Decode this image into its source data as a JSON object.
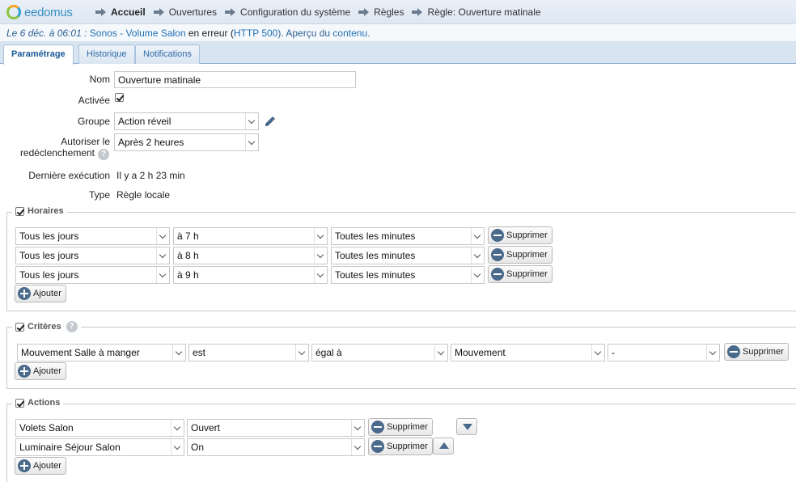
{
  "header": {
    "logo_text": "eedomus",
    "breadcrumbs": [
      "Accueil",
      "Ouvertures",
      "Configuration du système",
      "Règles",
      "Règle: Ouverture matinale"
    ]
  },
  "notification": {
    "date": "Le 6 déc. à 06:01 :",
    "device": "Sonos - Volume Salon",
    "status": "en erreur (",
    "error_code": "HTTP 500",
    "suffix": "). Aperçu du",
    "content_link": "contenu",
    "end": "."
  },
  "tabs": [
    {
      "label": "Paramétrage",
      "active": true
    },
    {
      "label": "Historique",
      "active": false
    },
    {
      "label": "Notifications",
      "active": false
    }
  ],
  "form": {
    "name_label": "Nom",
    "name_value": "Ouverture matinale",
    "active_label": "Activée",
    "active_checked": true,
    "group_label": "Groupe",
    "group_value": "Action réveil",
    "retrigger_label_1": "Autoriser le",
    "retrigger_label_2": "redéclenchement",
    "retrigger_value": "Après 2 heures",
    "last_exec_label": "Dernière exécution",
    "last_exec_value": "Il y a 2 h 23 min",
    "type_label": "Type",
    "type_value": "Règle locale"
  },
  "horaires": {
    "title": "Horaires",
    "rows": [
      {
        "day": "Tous les jours",
        "hour": "à 7 h",
        "minute": "Toutes les minutes",
        "delete": "Supprimer"
      },
      {
        "day": "Tous les jours",
        "hour": "à 8 h",
        "minute": "Toutes les minutes",
        "delete": "Supprimer"
      },
      {
        "day": "Tous les jours",
        "hour": "à 9 h",
        "minute": "Toutes les minutes",
        "delete": "Supprimer"
      }
    ],
    "add": "Ajouter"
  },
  "criteres": {
    "title": "Critères",
    "rows": [
      {
        "device": "Mouvement Salle à manger",
        "op": "est",
        "cmp": "égal à",
        "value": "Mouvement",
        "extra": "-",
        "delete": "Supprimer"
      }
    ],
    "add": "Ajouter"
  },
  "actions": {
    "title": "Actions",
    "rows": [
      {
        "device": "Volets Salon",
        "value": "Ouvert",
        "delete": "Supprimer"
      },
      {
        "device": "Luminaire Séjour Salon",
        "value": "On",
        "delete": "Supprimer"
      }
    ],
    "add": "Ajouter"
  },
  "icons": {
    "edit": "pencil-icon",
    "help": "question-icon",
    "remove": "minus-circle-icon",
    "add": "plus-circle-icon",
    "move_down": "arrow-down-icon",
    "move_up": "arrow-up-icon"
  },
  "colors": {
    "accent": "#1b5a9a",
    "header_bg": "#dde7f3",
    "link": "#1f6fb5",
    "button_icon": "#4a6a8c"
  }
}
